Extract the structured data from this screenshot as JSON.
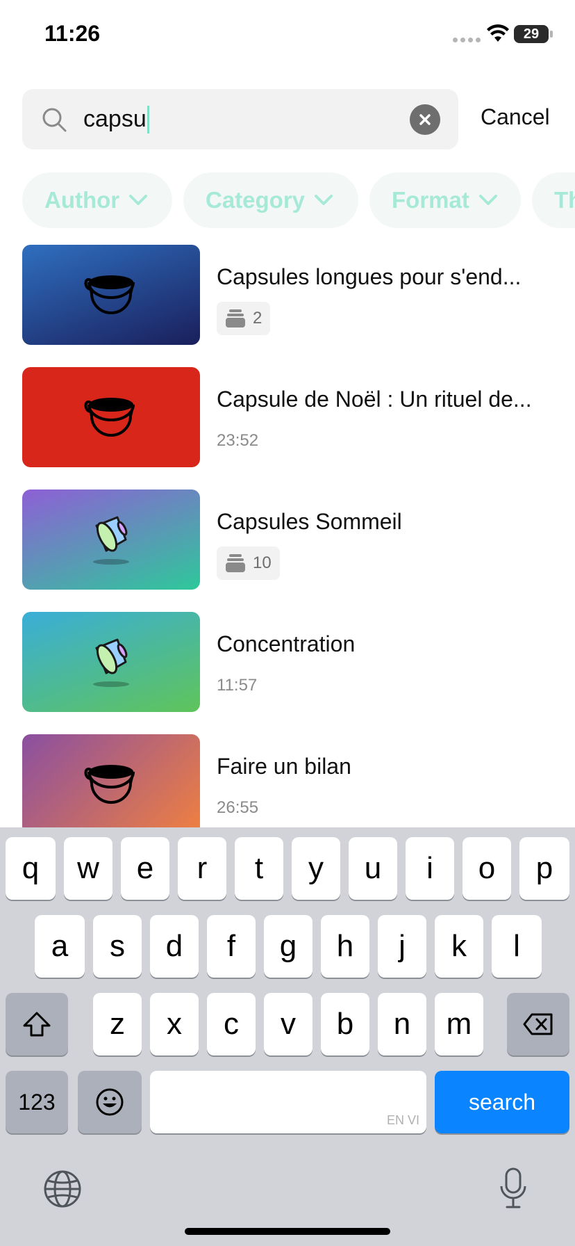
{
  "status_bar": {
    "time": "11:26",
    "battery": "29"
  },
  "search": {
    "query": "capsu",
    "cancel_label": "Cancel"
  },
  "filters": [
    {
      "label": "Author"
    },
    {
      "label": "Category"
    },
    {
      "label": "Format"
    },
    {
      "label": "Th"
    }
  ],
  "results": [
    {
      "title": "Capsules longues pour s'end...",
      "meta_type": "count",
      "meta": "2",
      "thumb_icon": "coffee-cup-icon",
      "thumb_colors": [
        "#2f6fbf",
        "#1a1f5c"
      ]
    },
    {
      "title": "Capsule de Noël : Un rituel de...",
      "meta_type": "duration",
      "meta": "23:52",
      "thumb_icon": "coffee-cup-icon",
      "thumb_colors": [
        "#d8261a",
        "#d8261a"
      ]
    },
    {
      "title": "Capsules Sommeil",
      "meta_type": "count",
      "meta": "10",
      "thumb_icon": "coffee-capsule-icon",
      "thumb_colors": [
        "#8e5fd6",
        "#2ec89a"
      ]
    },
    {
      "title": "Concentration",
      "meta_type": "duration",
      "meta": "11:57",
      "thumb_icon": "coffee-capsule-icon",
      "thumb_colors": [
        "#3aaed8",
        "#5fc45a"
      ]
    },
    {
      "title": "Faire un bilan",
      "meta_type": "duration",
      "meta": "26:55",
      "thumb_icon": "coffee-cup-icon",
      "thumb_colors": [
        "#8a4fa0",
        "#f08040"
      ]
    }
  ],
  "keyboard": {
    "row1": [
      "q",
      "w",
      "e",
      "r",
      "t",
      "y",
      "u",
      "i",
      "o",
      "p"
    ],
    "row2": [
      "a",
      "s",
      "d",
      "f",
      "g",
      "h",
      "j",
      "k",
      "l"
    ],
    "row3": [
      "z",
      "x",
      "c",
      "v",
      "b",
      "n",
      "m"
    ],
    "numbers_label": "123",
    "search_label": "search",
    "space_hint": "EN VI"
  },
  "colors": {
    "accent": "#a6e9d6",
    "keyboard_bg": "#d1d3d9",
    "search_key": "#0a84ff"
  }
}
